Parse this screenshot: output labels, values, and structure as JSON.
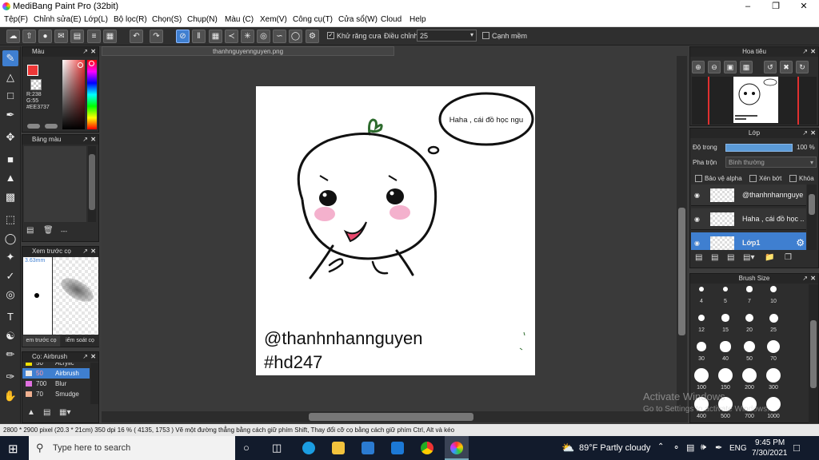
{
  "title": "MediBang Paint Pro (32bit)",
  "menu": [
    "Tệp(F)",
    "Chỉnh sửa(E)",
    "Lớp(L)",
    "Bộ lọc(R)",
    "Chọn(S)",
    "Chụp(N)",
    "Màu (C)",
    "Xem(V)",
    "Công cụ(T)",
    "Cửa sổ(W)",
    "Cloud",
    "Help"
  ],
  "toolbar": {
    "antialias_label": "Khử răng cưa",
    "adjust_label": "Điều chỉnh",
    "adjust_value": "25",
    "edge_label": "Cạnh mềm"
  },
  "color_panel": {
    "title": "Màu",
    "r": "R:238",
    "g": "G:55",
    "hex": "#EE3737",
    "main_color": "#EE3737"
  },
  "palette_panel": {
    "title": "Bảng màu",
    "dash": "---"
  },
  "preview_panel": {
    "title": "Xem trước cọ",
    "size": "3.63mm"
  },
  "preview_tabs": [
    "em trước cọ",
    "iểm soát cọ"
  ],
  "brush_panel": {
    "title": "Cọ: Airbrush",
    "items": [
      {
        "size": "50",
        "name": "Acrylic",
        "color": "#f0e000"
      },
      {
        "size": "50",
        "name": "Airbrush",
        "color": "#e8e8e8",
        "selected": true
      },
      {
        "size": "700",
        "name": "Blur",
        "color": "#e070e0"
      },
      {
        "size": "70",
        "name": "Smudge",
        "color": "#f0b090"
      }
    ]
  },
  "document": {
    "tab": "thanhnguyennguyen.png",
    "speech": "Haha , cái đồ học ngu",
    "line1": "@thanhnhannguyen",
    "line2": "#hd247"
  },
  "navigator": {
    "title": "Hoa tiêu"
  },
  "layer_panel": {
    "title": "Lớp",
    "opacity_label": "Độ trong",
    "opacity_value": "100 %",
    "blend_label": "Pha trộn",
    "blend_value": "Bình thường",
    "protect_alpha": "Bảo vệ alpha",
    "clip": "Xén bớt",
    "lock": "Khóa",
    "layers": [
      {
        "name": "@thanhnhannguye"
      },
      {
        "name": "Haha , cái đồ học ..."
      },
      {
        "name": "Lớp1",
        "selected": true
      }
    ]
  },
  "brushsize_panel": {
    "title": "Brush Size",
    "sizes": [
      "4",
      "5",
      "7",
      "10",
      "12",
      "15",
      "20",
      "25",
      "30",
      "40",
      "50",
      "70",
      "100",
      "150",
      "200",
      "300",
      "400",
      "500",
      "700",
      "1000"
    ]
  },
  "status": "2800 * 2900 pixel   (20.3 * 21cm)   350 dpi    16 %    ( 4135, 1753 )   Vẽ một đường thẳng bằng cách giữ phím Shift, Thay đổi cỡ cọ bằng cách giữ phím Ctrl, Alt và kéo",
  "watermark": {
    "line1": "Activate Windows",
    "line2": "Go to Settings to activate Windows."
  },
  "taskbar": {
    "search": "Type here to search",
    "weather": "89°F  Partly cloudy",
    "lang": "ENG",
    "time": "9:45 PM",
    "date": "7/30/2021"
  }
}
